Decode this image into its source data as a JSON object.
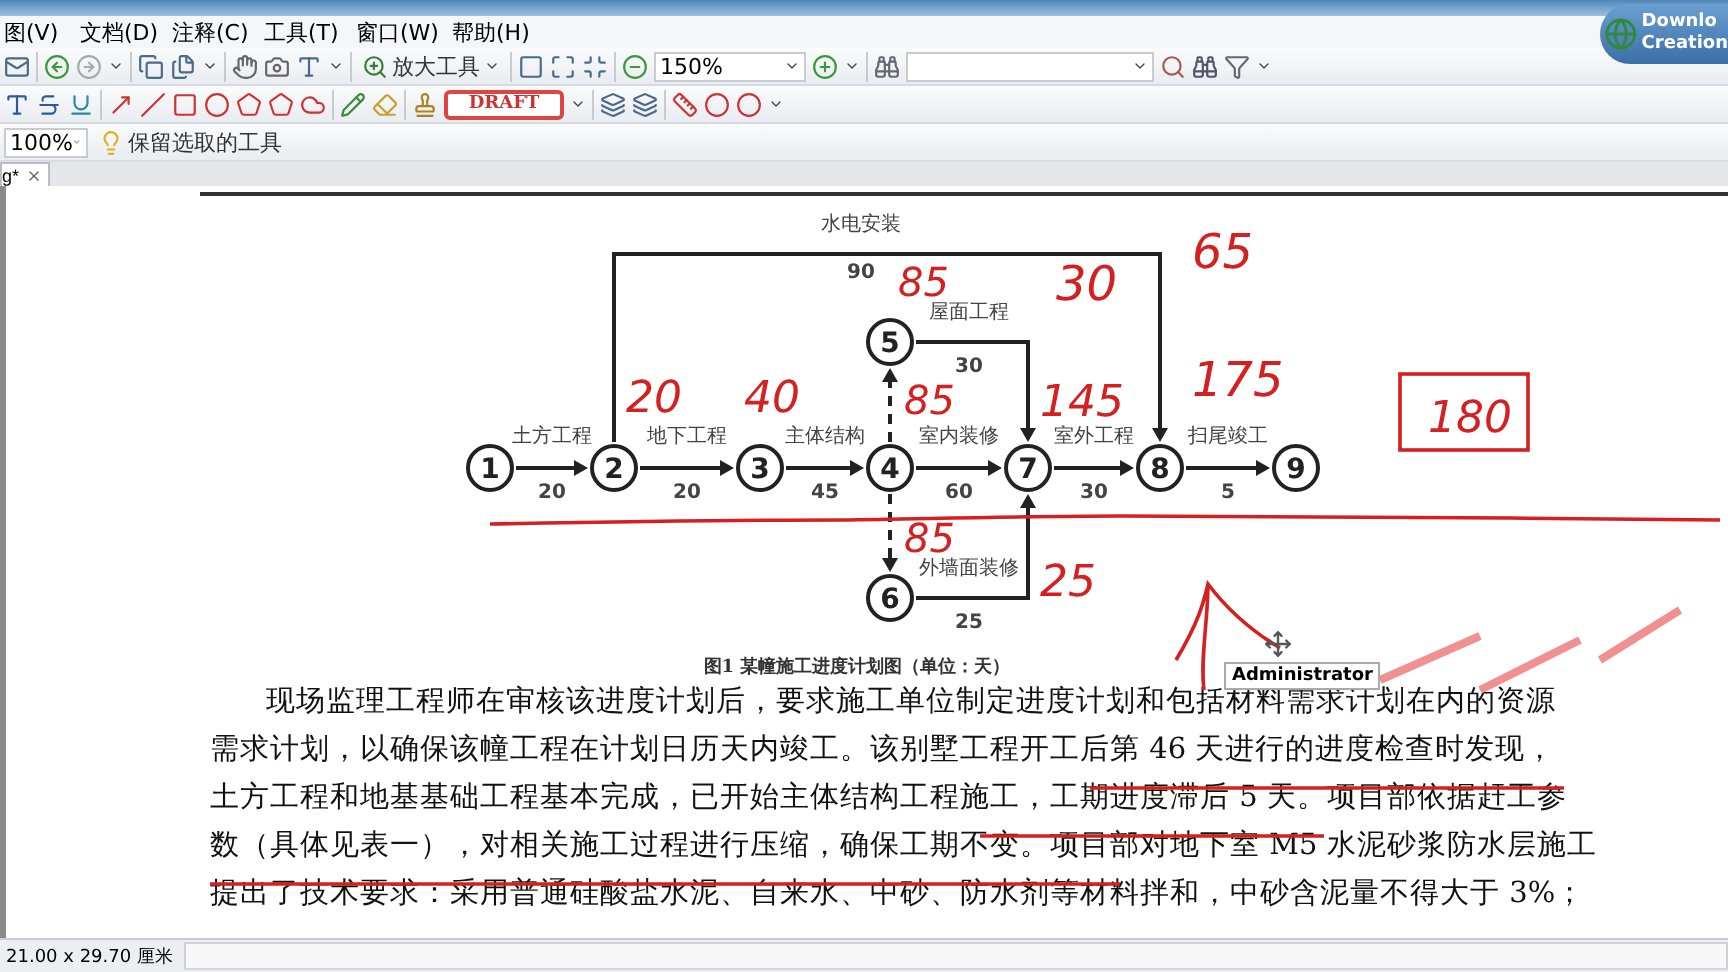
{
  "menu": [
    "图(V)",
    "文档(D)",
    "注释(C)",
    "工具(T)",
    "窗口(W)",
    "帮助(H)"
  ],
  "toolbar": {
    "zoom_tool": "放大工具",
    "zoom_level": "150%",
    "stamp": "DRAFT",
    "view_zoom": "100%",
    "keep_tool": "保留选取的工具"
  },
  "promo": [
    "Downlo",
    "Creation"
  ],
  "tab": {
    "title": "g*"
  },
  "diagram": {
    "nodes": [
      "5",
      "1",
      "2",
      "3",
      "4",
      "7",
      "8",
      "9",
      "6"
    ],
    "activities": [
      {
        "kind": "over",
        "name": "水电安装",
        "duration": "90"
      },
      {
        "kind": "dummy"
      },
      {
        "kind": "elbow",
        "name": "屋面工程",
        "duration": "30"
      },
      {
        "kind": "straight",
        "name": "土方工程",
        "duration": "20"
      },
      {
        "kind": "straight",
        "name": "地下工程",
        "duration": "20"
      },
      {
        "kind": "straight",
        "name": "主体结构",
        "duration": "45"
      },
      {
        "kind": "straight",
        "name": "室内装修",
        "duration": "60"
      },
      {
        "kind": "straight",
        "name": "室外工程",
        "duration": "30"
      },
      {
        "kind": "straight",
        "name": "扫尾竣工",
        "duration": "5"
      },
      {
        "kind": "dummy"
      },
      {
        "kind": "elbow",
        "name": "外墙面装修",
        "duration": "25"
      }
    ],
    "caption": "图1 某幢施工进度计划图（单位：天）"
  },
  "paragraph_lines": [
    "现场监理工程师在审核该进度计划后，要求施工单位制定进度计划和包括材料需求计划在内的资源",
    "需求计划，以确保该幢工程在计划日历天内竣工。该别墅工程开工后第 46 天进行的进度检查时发现，",
    "土方工程和地基基础工程基本完成，已开始主体结构工程施工，工期进度滞后 5 天。项目部依据赶工参",
    "数（具体见表一），对相关施工过程进行压缩，确保工期不变。项目部对地下室 M5 水泥砂浆防水层施工",
    "提出了技术要求：采用普通硅酸盐水泥、自来水、中砂、防水剂等材料拌和，中砂含泥量不得大于 3%；"
  ],
  "handwritten": [
    "65",
    "85",
    "30",
    "175",
    "180",
    "20",
    "40",
    "85",
    "145",
    "85",
    "25"
  ],
  "tooltip": "Administrator",
  "status": {
    "page_size": "21.00 x 29.70 厘米"
  }
}
